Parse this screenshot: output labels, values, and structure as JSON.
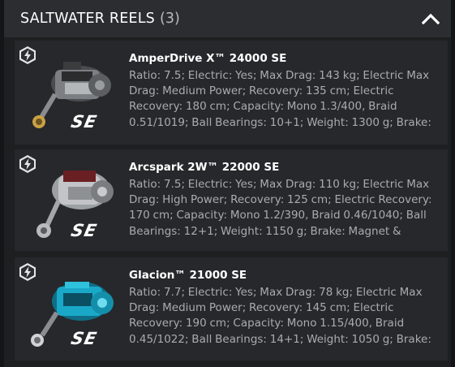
{
  "header": {
    "title": "SALTWATER REELS",
    "count": "(3)",
    "collapse_icon": "chevron-up-icon"
  },
  "reels": [
    {
      "name": "AmperDrive X™ 24000 SE",
      "description": "Ratio: 7.5; Electric: Yes; Max Drag: 143 kg; Electric Max Drag: Medium Power; Recovery: 135 cm; Electric Recovery: 180 cm; Capacity: Mono 1.3/400, Braid 0.51/1019; Ball Bearings: 10+1; Weight: 1300 g; Brake: …",
      "series_logo": "SE",
      "accent": "#8a8d90"
    },
    {
      "name": "Arcspark 2W™ 22000 SE",
      "description": "Ratio: 7.5; Electric: Yes; Max Drag: 110 kg; Electric Max Drag: High Power; Recovery: 125 cm; Electric Recovery: 170 cm; Capacity: Mono 1.2/390, Braid 0.46/1040; Ball Bearings: 12+1; Weight: 1150 g; Brake: Magnet & Centri…",
      "series_logo": "SE",
      "accent": "#6a1f22"
    },
    {
      "name": "Glacion™ 21000 SE",
      "description": "Ratio: 7.7; Electric: Yes; Max Drag: 78 kg; Electric Max Drag: Medium Power; Recovery: 145 cm; Electric Recovery: 190 cm; Capacity: Mono 1.15/400, Braid 0.45/1022; Ball Bearings: 14+1; Weight: 1050 g; Brake: …",
      "series_logo": "SE",
      "accent": "#1aa8c8"
    }
  ]
}
